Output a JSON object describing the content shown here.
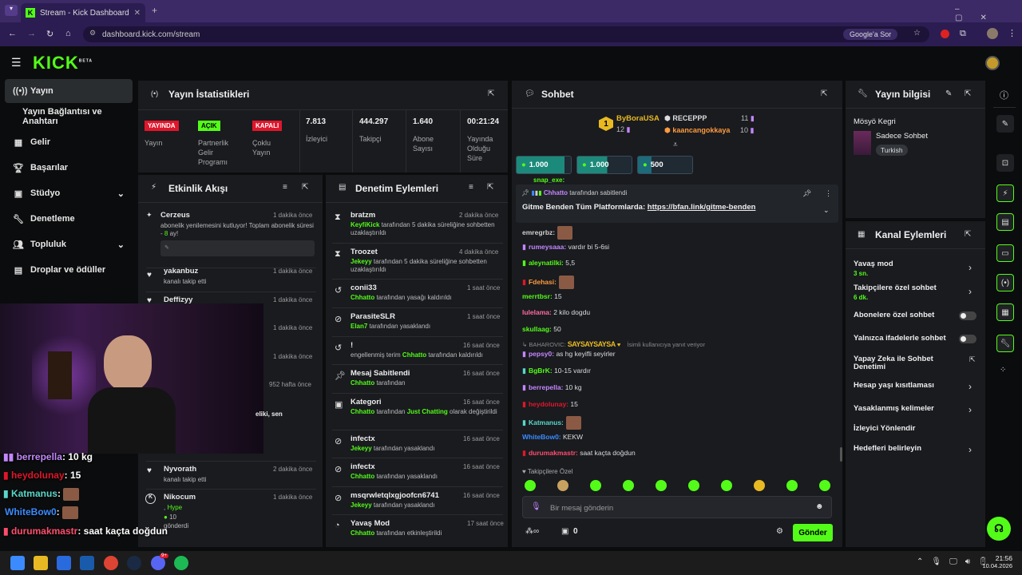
{
  "browser": {
    "tab_title": "Stream - Kick Dashboard",
    "url": "dashboard.kick.com/stream",
    "google_btn": "Google'a Sor"
  },
  "header": {
    "logo": "KICK",
    "beta": "BETA"
  },
  "sidebar": {
    "items": [
      {
        "label": "Yayın",
        "icon": "broadcast-icon"
      },
      {
        "label": "Yayın Bağlantısı ve Anahtarı",
        "icon": ""
      },
      {
        "label": "Gelir",
        "icon": "chart-icon"
      },
      {
        "label": "Başarılar",
        "icon": "trophy-icon"
      },
      {
        "label": "Stüdyo",
        "icon": "studio-icon"
      },
      {
        "label": "Denetleme",
        "icon": "wrench-icon"
      },
      {
        "label": "Topluluk",
        "icon": "community-icon"
      },
      {
        "label": "Droplar ve ödüller",
        "icon": "gift-icon"
      }
    ]
  },
  "stats": {
    "title": "Yayın İstatistikleri",
    "badges": [
      {
        "badge": "YAYINDA",
        "label": "Yayın",
        "color": "#e0162b"
      },
      {
        "badge": "AÇIK",
        "label": "Partnerlik Gelir Programı",
        "color": "#53fc18"
      },
      {
        "badge": "KAPALI",
        "label": "Çoklu Yayın",
        "color": "#e0162b"
      }
    ],
    "values": [
      {
        "value": "7.813",
        "label": "İzleyici"
      },
      {
        "value": "444.297",
        "label": "Takipçi"
      },
      {
        "value": "1.640",
        "label": "Abone Sayısı"
      },
      {
        "value": "00:21:24",
        "label": "Yayında Olduğu Süre"
      }
    ]
  },
  "activity": {
    "title": "Etkinlik Akışı",
    "items": [
      {
        "user": "Cerzeus",
        "time": "1 dakika önce",
        "text": "abonelik yenilemesini kutluyor! Toplam abonelik süresi - ",
        "months": "8",
        "suffix": " ay!"
      },
      {
        "user": "yakanbuz",
        "time": "1 dakika önce",
        "text": "kanalı takip etti"
      },
      {
        "user": "Deffizyy",
        "time": "1 dakika önce",
        "text": ""
      },
      {
        "time": "1 dakika önce"
      },
      {
        "time": "1 dakika önce"
      },
      {
        "time": "952 hafta önce"
      },
      {
        "text": "eliki, sen"
      },
      {
        "user": "Nyvorath",
        "time": "2 dakika önce",
        "text": "kanalı takip etti"
      },
      {
        "user": "Nikocum",
        "time": "1 dakika önce",
        "hype": "Hype",
        "count": "10",
        "text": "gönderdi"
      }
    ]
  },
  "moderation": {
    "title": "Denetim Eylemleri",
    "items": [
      {
        "user": "bratzm",
        "time": "2 dakika önce",
        "actor": "KeyfiKick",
        "text": " tarafından 5 dakika süreliğine sohbetten uzaklaştırıldı"
      },
      {
        "user": "Troozet",
        "time": "4 dakika önce",
        "actor": "Jekeyy",
        "text": " tarafından 5 dakika süreliğine sohbetten uzaklaştırıldı"
      },
      {
        "user": "conii33",
        "time": "1 saat önce",
        "actor": "Chhatto",
        "text": " tarafından yasağı kaldırıldı"
      },
      {
        "user": "ParasiteSLR",
        "time": "1 saat önce",
        "actor": "Elan7",
        "text": " tarafından yasaklandı"
      },
      {
        "user": "!",
        "time": "16 saat önce",
        "pre": "engellenmiş terim ",
        "actor": "Chhatto",
        "text": " tarafından kaldırıldı"
      },
      {
        "user": "Mesaj Sabitlendi",
        "time": "16 saat önce",
        "actor": "Chhatto",
        "text": " tarafından"
      },
      {
        "user": "Kategori",
        "time": "16 saat önce",
        "actor": "Chhatto",
        "text": " tarafından ",
        "cat": "Just Chatting",
        "text2": " olarak değiştirildi"
      },
      {
        "user": "infectx",
        "time": "16 saat önce",
        "actor": "Jekeyy",
        "text": " tarafından yasaklandı"
      },
      {
        "user": "infectx",
        "time": "16 saat önce",
        "actor": "Chhatto",
        "text": " tarafından yasaklandı"
      },
      {
        "user": "msqrwletqlxgjoofcn6741",
        "time": "16 saat önce",
        "actor": "Jekeyy",
        "text": " tarafından yasaklandı"
      },
      {
        "user": "Yavaş Mod",
        "time": "17 saat önce",
        "actor": "Chhatto",
        "text": " tarafından etkinleştirildi"
      }
    ]
  },
  "chat": {
    "title": "Sohbet",
    "leaderboard": [
      {
        "rank": "1",
        "name": "ByBoraUSA",
        "count": "12"
      },
      {
        "name": "RECEPPP",
        "count": "11"
      },
      {
        "name": "kaancangokkaya",
        "count": "10"
      }
    ],
    "kicks": [
      "1.000",
      "1.000",
      "500"
    ],
    "cut_user": "snap_exe:",
    "pinned": {
      "by": "Chhatto",
      "by_text": " tarafından sabitlendi",
      "text": "Gitme Benden Tüm Platformlarda: ",
      "link": "https://bfan.link/gitme-benden"
    },
    "messages": [
      {
        "user": "emregrbz:",
        "text": "",
        "color": "#d0d0d0",
        "emote": true
      },
      {
        "user": "rumeysaaa:",
        "text": " vardır bi 5-6si",
        "color": "#c586ff"
      },
      {
        "user": "aleynatilki:",
        "text": " 5,5",
        "color": "#53fc18"
      },
      {
        "user": "Fdehasi:",
        "text": "",
        "color": "#ff9a3d",
        "emote": true
      },
      {
        "user": "merrtbsr:",
        "text": " 15",
        "color": "#53fc18"
      },
      {
        "user": "lulelama:",
        "text": " 2 kilo dogdu",
        "color": "#ff6b9e"
      },
      {
        "user": "skullaag:",
        "text": " 50",
        "color": "#53fc18"
      },
      {
        "user": "pepsy0:",
        "text": " as hg keyifli seyirler",
        "color": "#c586ff"
      },
      {
        "user": "BgBrK:",
        "text": " 10-15 vardır",
        "color": "#53fc18"
      },
      {
        "user": "berrepella:",
        "text": " 10 kg",
        "color": "#c586ff"
      },
      {
        "user": "heydolunay:",
        "text": " 15",
        "color": "#e0162b"
      },
      {
        "user": "Katmanus:",
        "text": "",
        "color": "#5ad7c9",
        "emote": true
      },
      {
        "user": "WhiteBow0:",
        "text": " KEKW",
        "color": "#3b8bff"
      },
      {
        "user": "durumakmastr:",
        "text": " saat kaçta doğdun",
        "color": "#ff4d6d"
      }
    ],
    "reply": {
      "user": "BAHAROVIC:",
      "art": "SAYSAYSAYSA",
      "text": "İsimli kullanıcıya yanıt veriyor"
    },
    "followers_only": "Takipçilere Özel",
    "placeholder": "Bir mesaj gönderin",
    "points": "0",
    "send": "Gönder"
  },
  "streaminfo": {
    "title": "Yayın bilgisi",
    "name": "Mösyö Kegri",
    "category": "Sadece Sohbet",
    "tag": "Turkish"
  },
  "channel": {
    "title": "Kanal Eylemleri",
    "items": [
      {
        "label": "Yavaş mod",
        "sub": "3 sn.",
        "type": "arrow"
      },
      {
        "label": "Takipçilere özel sohbet",
        "sub": "6 dk.",
        "type": "arrow"
      },
      {
        "label": "Abonelere özel sohbet",
        "sub": "",
        "type": "toggle"
      },
      {
        "label": "Yalnızca ifadelerle sohbet",
        "sub": "",
        "type": "toggle"
      },
      {
        "label": "Yapay Zeka ile Sohbet Denetimi",
        "sub": "",
        "type": "external"
      },
      {
        "label": "Hesap yaşı kısıtlaması",
        "sub": "",
        "type": "arrow"
      },
      {
        "label": "Yasaklanmış kelimeler",
        "sub": "",
        "type": "arrow"
      },
      {
        "label": "İzleyici Yönlendir",
        "sub": "",
        "type": "none"
      },
      {
        "label": "Hedefleri belirleyin",
        "sub": "",
        "type": "arrow"
      }
    ]
  },
  "overlay": [
    {
      "user": "berrepella",
      "text": ": 10 kg",
      "color": "#c586ff"
    },
    {
      "user": "heydolunay",
      "text": ": 15",
      "color": "#e0162b"
    },
    {
      "user": "Katmanus",
      "text": ":",
      "color": "#5ad7c9"
    },
    {
      "user": "WhiteBow0",
      "text": ":",
      "color": "#3b8bff"
    },
    {
      "user": "durumakmastr",
      "text": ": saat kaçta doğdun",
      "color": "#ff4d6d"
    }
  ],
  "taskbar": {
    "time": "21:56",
    "date": "10.04.2026",
    "badge": "9+"
  }
}
